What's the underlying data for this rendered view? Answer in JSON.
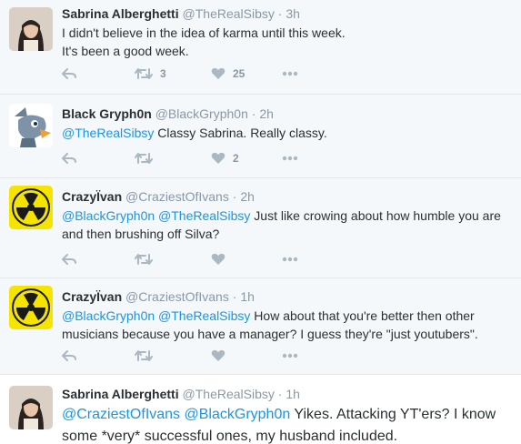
{
  "tweets": [
    {
      "name": "Sabrina Alberghetti",
      "handle": "@TheRealSibsy",
      "dot": "·",
      "time": "3h",
      "text_line1": "I didn't believe in the idea of karma until this week.",
      "text_line2": "It's been a good week.",
      "retweets": "3",
      "likes": "25"
    },
    {
      "name": "Black Gryph0n",
      "handle": "@BlackGryph0n",
      "dot": "·",
      "time": "2h",
      "mention1": "@TheRealSibsy",
      "text": " Classy Sabrina. Really classy.",
      "retweets": "",
      "likes": "2"
    },
    {
      "name": "CrazyÏvan",
      "handle": "@CraziestOfIvans",
      "dot": "·",
      "time": "2h",
      "mention1": "@BlackGryph0n",
      "mention2": "@TheRealSibsy",
      "text_line1": " Just like crowing about how humble you are",
      "text_line2": "and then brushing off Silva?",
      "retweets": "",
      "likes": ""
    },
    {
      "name": "CrazyÏvan",
      "handle": "@CraziestOfIvans",
      "dot": "·",
      "time": "1h",
      "mention1": "@BlackGryph0n",
      "mention2": "@TheRealSibsy",
      "text_line1": " How about that you're better then other",
      "text_line2": "musicians because you have a manager? I guess they're \"just youtubers\".",
      "retweets": "",
      "likes": ""
    },
    {
      "name": "Sabrina Alberghetti",
      "handle": "@TheRealSibsy",
      "dot": "·",
      "time": "1h",
      "mention1": "@CraziestOfIvans",
      "mention2": "@BlackGryph0n",
      "text_line1": " Yikes. Attacking YT'ers? I know",
      "text_line2": "some *very* successful ones, my husband included."
    }
  ],
  "icons": {
    "reply": "reply-icon",
    "retweet": "retweet-icon",
    "like": "heart-icon",
    "more": "more-icon"
  },
  "colors": {
    "link": "#1b95e0",
    "muted": "#8899a6",
    "background": "#f5f8fa"
  }
}
